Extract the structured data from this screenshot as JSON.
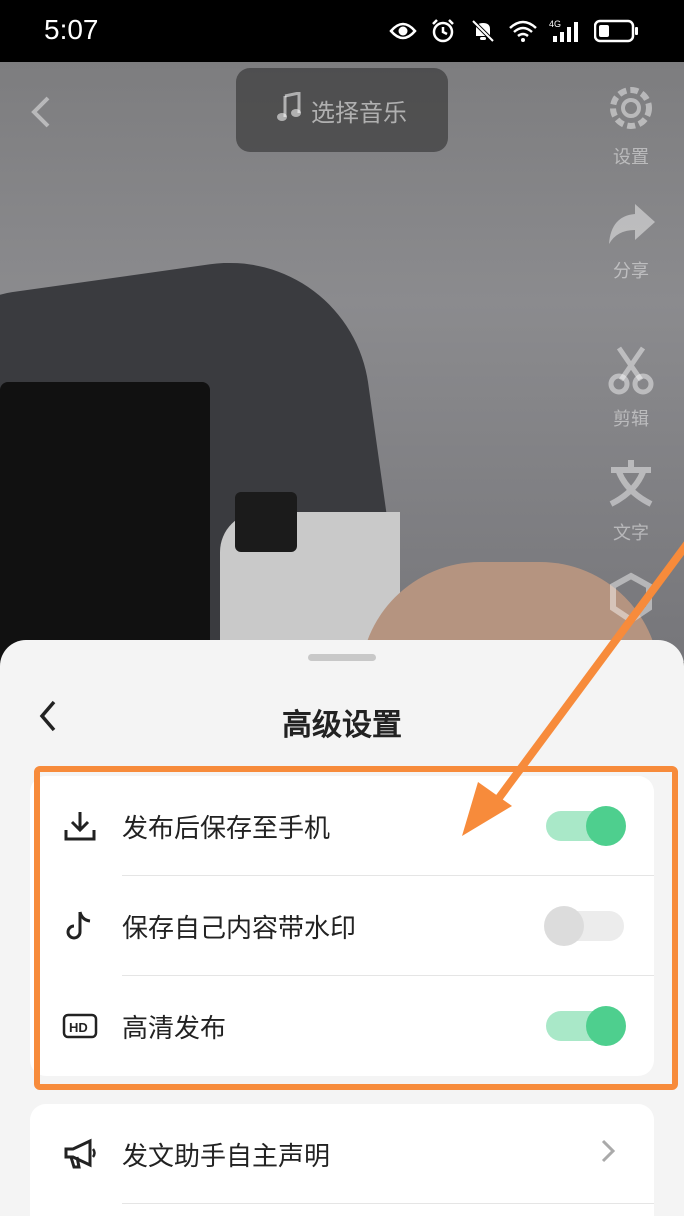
{
  "status_bar": {
    "time": "5:07",
    "icons": [
      "eye-icon",
      "alarm-icon",
      "mute-icon",
      "wifi-icon",
      "signal-4g-icon",
      "battery-icon"
    ]
  },
  "video_screen": {
    "music_button_label": "选择音乐",
    "tools": [
      {
        "label": "设置",
        "icon": "gear-icon"
      },
      {
        "label": "分享",
        "icon": "share-icon"
      },
      {
        "label": "剪辑",
        "icon": "scissors-icon"
      },
      {
        "label": "文字",
        "icon": "text-icon"
      }
    ]
  },
  "sheet": {
    "title": "高级设置",
    "group1": [
      {
        "label": "发布后保存至手机",
        "icon": "download-icon",
        "toggle": true
      },
      {
        "label": "保存自己内容带水印",
        "icon": "tiktok-note-icon",
        "toggle": false
      },
      {
        "label": "高清发布",
        "icon": "hd-icon",
        "toggle": true
      }
    ],
    "group2": [
      {
        "label": "发文助手自主声明",
        "icon": "megaphone-icon"
      }
    ]
  },
  "colors": {
    "toggle_on": "#4ecf8e",
    "toggle_on_track": "#a9e8c8",
    "highlight": "#f78b3b"
  }
}
